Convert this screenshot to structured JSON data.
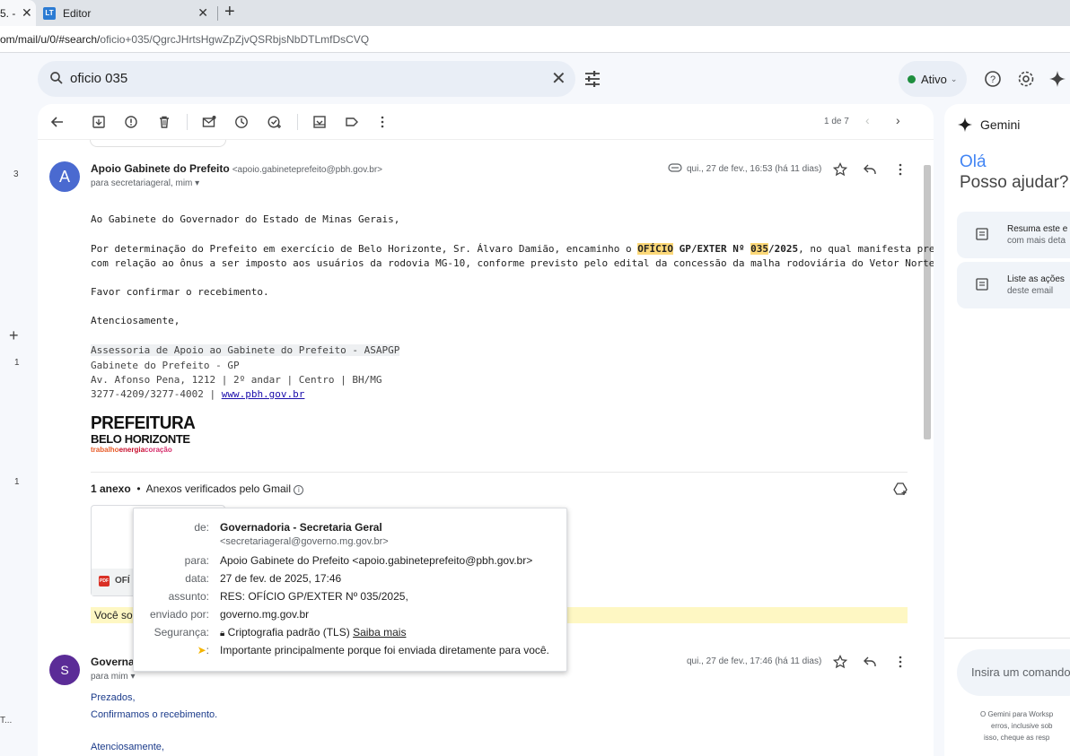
{
  "browser": {
    "tabs": [
      {
        "label": "5. -",
        "partial": true
      },
      {
        "label": "Editor",
        "icon_text": "LT"
      }
    ],
    "url_prefix": "om/mail/u/0/#search/",
    "url_rest": "oficio+035/QgrcJHrtsHgwZpZjvQSRbjsNbDTLmfDsCVQ"
  },
  "search": {
    "query": "oficio 035"
  },
  "status": {
    "label": "Ativo",
    "color": "#1e8e3e"
  },
  "rail": {
    "counts": [
      "3",
      "1",
      "1"
    ],
    "bottom_label": "T..."
  },
  "toolbar": {
    "pager": "1 de 7"
  },
  "email1": {
    "avatar": "A",
    "avatar_color": "#4a6ad0",
    "sender": "Apoio Gabinete do Prefeito",
    "sender_email": "<apoio.gabineteprefeito@pbh.gov.br>",
    "to": "para secretariageral, mim",
    "date": "qui., 27 de fev., 16:53 (há 11 dias)",
    "greeting": "Ao Gabinete do Governador do Estado de Minas Gerais,",
    "para1_a": "Por determinação do Prefeito em exercício de Belo Horizonte, Sr. Álvaro Damião, encaminho o ",
    "para1_hl1": "OFÍCIO",
    "para1_b": " GP/EXTER Nº ",
    "para1_hl2": "035",
    "para1_c": "/2025",
    "para1_d": ", no qual manifesta preocupação",
    "para2": "com relação ao ônus a ser imposto aos usuários da rodovia MG-10, conforme previsto pelo edital da concessão da malha rodoviária do Vetor Norte.",
    "confirm": "Favor confirmar o recebimento.",
    "closing": "Atenciosamente,",
    "sig1": "Assessoria de Apoio ao Gabinete do Prefeito - ASAPGP",
    "sig2": "Gabinete do Prefeito - GP",
    "sig3": "Av. Afonso Pena, 1212 | 2º andar | Centro | BH/MG",
    "sig4_phone": "3277-4209/3277-4002 | ",
    "sig4_link": "www.pbh.gov.br",
    "logo_line1": "PREFEITURA",
    "logo_line2": "BELO HORIZONTE",
    "logo_w1": "trabalho",
    "logo_w2": "energia",
    "logo_w3": "coração",
    "attachments_count": "1 anexo",
    "attachments_verified": "Anexos verificados pelo Gmail",
    "attachment_name": "OFÍ",
    "yellow_text": "Você so"
  },
  "email2": {
    "avatar": "S",
    "avatar_color": "#5b2c97",
    "sender": "Governa",
    "to": "para mim",
    "date": "qui., 27 de fev., 17:46 (há 11 dias)",
    "line1": "Prezados,",
    "line2": "Confirmamos o recebimento.",
    "line3": "Atenciosamente,"
  },
  "popover": {
    "from_label": "de:",
    "from_name": "Governadoria - Secretaria Geral",
    "from_email": "<secretariageral@governo.mg.gov.br>",
    "to_label": "para:",
    "to_value": "Apoio Gabinete do Prefeito <apoio.gabineteprefeito@pbh.gov.br>",
    "date_label": "data:",
    "date_value": "27 de fev. de 2025, 17:46",
    "subject_label": "assunto:",
    "subject_value": "RES: OFÍCIO GP/EXTER Nº 035/2025,",
    "sentby_label": "enviado por:",
    "sentby_value": "governo.mg.gov.br",
    "security_label": "Segurança:",
    "security_value": "Criptografia padrão (TLS) ",
    "security_link": "Saiba mais",
    "importance_label": ":",
    "importance_value": "Importante principalmente porque foi enviada diretamente para você.",
    "importance_color": "#f4b400"
  },
  "gemini": {
    "title": "Gemini",
    "hello": "Olá",
    "ask": "Posso ajudar?",
    "card1_line1": "Resuma este e",
    "card1_line2": "com mais deta",
    "card2_line1": "Liste as ações",
    "card2_line2": "deste email",
    "input_placeholder": "Insira um comando",
    "footer1": "O Gemini para Worksp",
    "footer2": "erros, inclusive sob",
    "footer3": "isso, cheque as resp"
  }
}
